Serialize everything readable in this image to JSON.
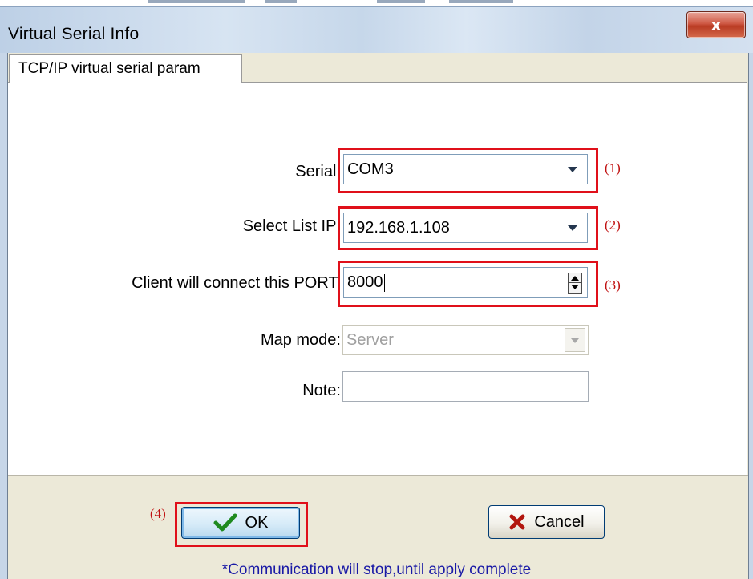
{
  "window": {
    "title": "Virtual Serial Info",
    "close_glyph": "x"
  },
  "tabs": [
    {
      "label": "TCP/IP virtual serial param",
      "active": true
    }
  ],
  "form": {
    "serial": {
      "label": "Serial:",
      "value": "COM3"
    },
    "select_list_ip": {
      "label": "Select List IP:",
      "value": "192.168.1.108"
    },
    "client_port": {
      "label": "Client will connect this PORT:",
      "value": "8000"
    },
    "map_mode": {
      "label": "Map mode:",
      "value": "Server",
      "disabled": true
    },
    "note": {
      "label": "Note:",
      "value": ""
    }
  },
  "annotations": {
    "a1": "(1)",
    "a2": "(2)",
    "a3": "(3)",
    "a4": "(4)"
  },
  "buttons": {
    "ok": "OK",
    "cancel": "Cancel"
  },
  "footer": {
    "hint": "*Communication will stop,until apply complete"
  },
  "colors": {
    "highlight": "#e0101a",
    "hint_text": "#1a1aa6",
    "annotation": "#c01010"
  },
  "icons": {
    "ok": "checkmark-icon",
    "cancel": "x-mark-icon",
    "close": "close-icon"
  }
}
